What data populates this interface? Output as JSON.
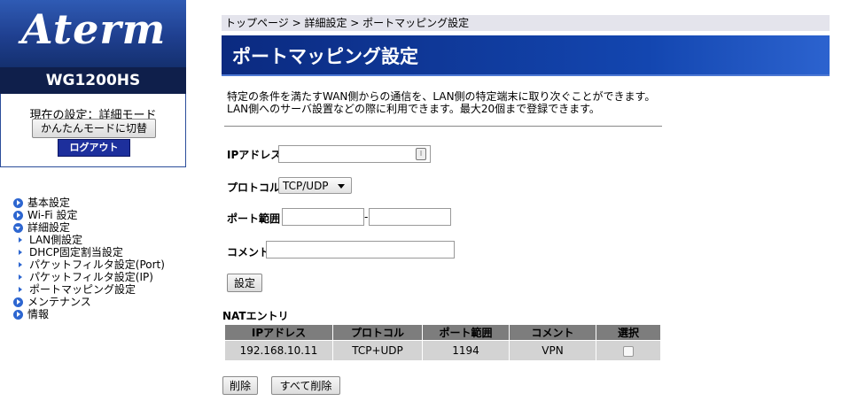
{
  "brand": {
    "logo": "Aterm",
    "model": "WG1200HS"
  },
  "mode": {
    "current": "現在の設定：詳細モード",
    "switch_button": "かんたんモードに切替",
    "logout_button": "ログアウト"
  },
  "menu": {
    "items": [
      {
        "label": "基本設定"
      },
      {
        "label": "Wi-Fi 設定"
      },
      {
        "label": "詳細設定"
      },
      {
        "label": "メンテナンス"
      },
      {
        "label": "情報"
      }
    ],
    "sub_items": [
      {
        "label": "LAN側設定"
      },
      {
        "label": "DHCP固定割当設定"
      },
      {
        "label": "パケットフィルタ設定(Port)"
      },
      {
        "label": "パケットフィルタ設定(IP)"
      },
      {
        "label": "ポートマッピング設定"
      }
    ]
  },
  "breadcrumb": "トップページ > 詳細設定 > ポートマッピング設定",
  "title": "ポートマッピング設定",
  "description": {
    "line1": "特定の条件を満たすWAN側からの通信を、LAN側の特定端末に取り次ぐことができます。",
    "line2": "LAN側へのサーバ設置などの際に利用できます。最大20個まで登録できます。"
  },
  "form": {
    "ip_label": "IPアドレス",
    "ip_value": "",
    "protocol_label": "プロトコル",
    "protocol_value": "TCP/UDP",
    "port_label": "ポート範囲",
    "port_from": "",
    "port_to": "",
    "port_separator": "-",
    "comment_label": "コメント",
    "comment_value": "",
    "submit": "設定"
  },
  "nat": {
    "title": "NATエントリ",
    "headers": [
      "IPアドレス",
      "プロトコル",
      "ポート範囲",
      "コメント",
      "選択"
    ],
    "rows": [
      {
        "ip": "192.168.10.11",
        "protocol": "TCP+UDP",
        "port": "1194",
        "comment": "VPN",
        "selected": false
      }
    ],
    "delete_button": "削除",
    "delete_all_button": "すべて削除"
  }
}
